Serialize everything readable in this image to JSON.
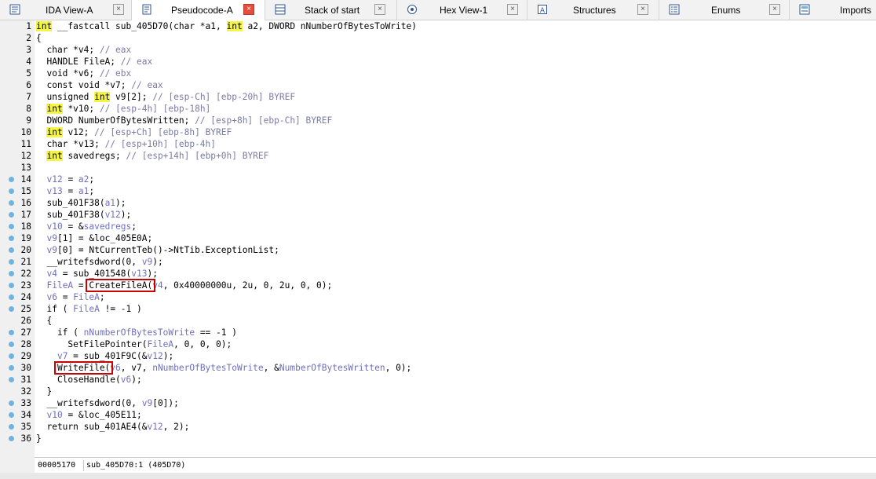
{
  "tabs": [
    {
      "label": "IDA View-A",
      "icon": "ida-view-icon",
      "active": false
    },
    {
      "label": "Pseudocode-A",
      "icon": "pseudocode-icon",
      "active": true
    },
    {
      "label": "Stack of start",
      "icon": "stack-icon",
      "active": false
    },
    {
      "label": "Hex View-1",
      "icon": "hex-view-icon",
      "active": false
    },
    {
      "label": "Structures",
      "icon": "structures-icon",
      "active": false
    },
    {
      "label": "Enums",
      "icon": "enums-icon",
      "active": false
    },
    {
      "label": "Imports",
      "icon": "imports-icon",
      "active": false
    }
  ],
  "code": {
    "lines": [
      {
        "n": "1",
        "dot": false,
        "tokens": [
          [
            "kw",
            "int"
          ],
          [
            "p",
            " __fastcall sub_405D70(char *a1, "
          ],
          [
            "kw",
            "int"
          ],
          [
            "p",
            " a2, DWORD nNumberOfBytesToWrite)"
          ]
        ]
      },
      {
        "n": "2",
        "dot": false,
        "tokens": [
          [
            "p",
            "{"
          ]
        ]
      },
      {
        "n": "3",
        "dot": false,
        "tokens": [
          [
            "p",
            "  char *v4; "
          ],
          [
            "cm",
            "// eax"
          ]
        ]
      },
      {
        "n": "4",
        "dot": false,
        "tokens": [
          [
            "p",
            "  HANDLE FileA; "
          ],
          [
            "cm",
            "// eax"
          ]
        ]
      },
      {
        "n": "5",
        "dot": false,
        "tokens": [
          [
            "p",
            "  void *v6; "
          ],
          [
            "cm",
            "// ebx"
          ]
        ]
      },
      {
        "n": "6",
        "dot": false,
        "tokens": [
          [
            "p",
            "  const void *v7; "
          ],
          [
            "cm",
            "// eax"
          ]
        ]
      },
      {
        "n": "7",
        "dot": false,
        "tokens": [
          [
            "p",
            "  unsigned "
          ],
          [
            "kw",
            "int"
          ],
          [
            "p",
            " v9[2]; "
          ],
          [
            "cm",
            "// [esp-Ch] [ebp-20h] BYREF"
          ]
        ]
      },
      {
        "n": "8",
        "dot": false,
        "tokens": [
          [
            "p",
            "  "
          ],
          [
            "kw",
            "int"
          ],
          [
            "p",
            " *v10; "
          ],
          [
            "cm",
            "// [esp-4h] [ebp-18h]"
          ]
        ]
      },
      {
        "n": "9",
        "dot": false,
        "tokens": [
          [
            "p",
            "  DWORD NumberOfBytesWritten; "
          ],
          [
            "cm",
            "// [esp+8h] [ebp-Ch] BYREF"
          ]
        ]
      },
      {
        "n": "10",
        "dot": false,
        "tokens": [
          [
            "p",
            "  "
          ],
          [
            "kw",
            "int"
          ],
          [
            "p",
            " v12; "
          ],
          [
            "cm",
            "// [esp+Ch] [ebp-8h] BYREF"
          ]
        ]
      },
      {
        "n": "11",
        "dot": false,
        "tokens": [
          [
            "p",
            "  char *v13; "
          ],
          [
            "cm",
            "// [esp+10h] [ebp-4h]"
          ]
        ]
      },
      {
        "n": "12",
        "dot": false,
        "tokens": [
          [
            "p",
            "  "
          ],
          [
            "kw",
            "int"
          ],
          [
            "p",
            " savedregs; "
          ],
          [
            "cm",
            "// [esp+14h] [ebp+0h] BYREF"
          ]
        ]
      },
      {
        "n": "13",
        "dot": false,
        "tokens": []
      },
      {
        "n": "14",
        "dot": true,
        "tokens": [
          [
            "p",
            "  "
          ],
          [
            "vr",
            "v12"
          ],
          [
            "p",
            " = "
          ],
          [
            "vr",
            "a2"
          ],
          [
            "p",
            ";"
          ]
        ]
      },
      {
        "n": "15",
        "dot": true,
        "tokens": [
          [
            "p",
            "  "
          ],
          [
            "vr",
            "v13"
          ],
          [
            "p",
            " = "
          ],
          [
            "vr",
            "a1"
          ],
          [
            "p",
            ";"
          ]
        ]
      },
      {
        "n": "16",
        "dot": true,
        "tokens": [
          [
            "p",
            "  sub_401F38("
          ],
          [
            "vr",
            "a1"
          ],
          [
            "p",
            ");"
          ]
        ]
      },
      {
        "n": "17",
        "dot": true,
        "tokens": [
          [
            "p",
            "  sub_401F38("
          ],
          [
            "vr",
            "v12"
          ],
          [
            "p",
            ");"
          ]
        ]
      },
      {
        "n": "18",
        "dot": true,
        "tokens": [
          [
            "p",
            "  "
          ],
          [
            "vr",
            "v10"
          ],
          [
            "p",
            " = &"
          ],
          [
            "vr",
            "savedregs"
          ],
          [
            "p",
            ";"
          ]
        ]
      },
      {
        "n": "19",
        "dot": true,
        "tokens": [
          [
            "p",
            "  "
          ],
          [
            "vr",
            "v9"
          ],
          [
            "p",
            "[1] = &loc_405E0A;"
          ]
        ]
      },
      {
        "n": "20",
        "dot": true,
        "tokens": [
          [
            "p",
            "  "
          ],
          [
            "vr",
            "v9"
          ],
          [
            "p",
            "[0] = NtCurrentTeb()->NtTib.ExceptionList;"
          ]
        ]
      },
      {
        "n": "21",
        "dot": true,
        "tokens": [
          [
            "p",
            "  __writefsdword(0, "
          ],
          [
            "vr",
            "v9"
          ],
          [
            "p",
            ");"
          ]
        ]
      },
      {
        "n": "22",
        "dot": true,
        "tokens": [
          [
            "p",
            "  "
          ],
          [
            "vr",
            "v4"
          ],
          [
            "p",
            " = sub_401548("
          ],
          [
            "vr",
            "v13"
          ],
          [
            "p",
            ");"
          ]
        ]
      },
      {
        "n": "23",
        "dot": true,
        "tokens": [
          [
            "p",
            "  "
          ],
          [
            "vr",
            "FileA"
          ],
          [
            "p",
            " = CreateFileA("
          ],
          [
            "vr",
            "v4"
          ],
          [
            "p",
            ", 0x40000000u, 2u, 0, 2u, 0, 0);"
          ]
        ]
      },
      {
        "n": "24",
        "dot": true,
        "tokens": [
          [
            "p",
            "  "
          ],
          [
            "vr",
            "v6"
          ],
          [
            "p",
            " = "
          ],
          [
            "vr",
            "FileA"
          ],
          [
            "p",
            ";"
          ]
        ]
      },
      {
        "n": "25",
        "dot": true,
        "tokens": [
          [
            "p",
            "  if ( "
          ],
          [
            "vr",
            "FileA"
          ],
          [
            "p",
            " != -1 )"
          ]
        ]
      },
      {
        "n": "26",
        "dot": false,
        "tokens": [
          [
            "p",
            "  {"
          ]
        ]
      },
      {
        "n": "27",
        "dot": true,
        "tokens": [
          [
            "p",
            "    if ( "
          ],
          [
            "vr",
            "nNumberOfBytesToWrite"
          ],
          [
            "p",
            " == -1 )"
          ]
        ]
      },
      {
        "n": "28",
        "dot": true,
        "tokens": [
          [
            "p",
            "      SetFilePointer("
          ],
          [
            "vr",
            "FileA"
          ],
          [
            "p",
            ", 0, 0, 0);"
          ]
        ]
      },
      {
        "n": "29",
        "dot": true,
        "tokens": [
          [
            "p",
            "    "
          ],
          [
            "vr",
            "v7"
          ],
          [
            "p",
            " = sub_401F9C(&"
          ],
          [
            "vr",
            "v12"
          ],
          [
            "p",
            ");"
          ]
        ]
      },
      {
        "n": "30",
        "dot": true,
        "tokens": [
          [
            "p",
            "    WriteFile("
          ],
          [
            "vr",
            "v6"
          ],
          [
            "p",
            ", v7, "
          ],
          [
            "vr",
            "nNumberOfBytesToWrite"
          ],
          [
            "p",
            ", &"
          ],
          [
            "vr",
            "NumberOfBytesWritten"
          ],
          [
            "p",
            ", 0);"
          ]
        ]
      },
      {
        "n": "31",
        "dot": true,
        "tokens": [
          [
            "p",
            "    CloseHandle("
          ],
          [
            "vr",
            "v6"
          ],
          [
            "p",
            ");"
          ]
        ]
      },
      {
        "n": "32",
        "dot": false,
        "tokens": [
          [
            "p",
            "  }"
          ]
        ]
      },
      {
        "n": "33",
        "dot": true,
        "tokens": [
          [
            "p",
            "  __writefsdword(0, "
          ],
          [
            "vr",
            "v9"
          ],
          [
            "p",
            "[0]);"
          ]
        ]
      },
      {
        "n": "34",
        "dot": true,
        "tokens": [
          [
            "p",
            "  "
          ],
          [
            "vr",
            "v10"
          ],
          [
            "p",
            " = &loc_405E11;"
          ]
        ]
      },
      {
        "n": "35",
        "dot": true,
        "tokens": [
          [
            "p",
            "  return sub_401AE4(&"
          ],
          [
            "vr",
            "v12"
          ],
          [
            "p",
            ", 2);"
          ]
        ]
      },
      {
        "n": "36",
        "dot": true,
        "tokens": [
          [
            "p",
            "}"
          ]
        ]
      }
    ],
    "highlight_keyword_color": "#f5f545",
    "comment_color": "#7b7ba6",
    "variable_color": "#6f6fbf"
  },
  "annotations": {
    "box_color": "#cc0000",
    "boxed_calls": [
      "CreateFileA",
      "WriteFile"
    ]
  },
  "status": {
    "address": "00005170",
    "location": "sub_405D70:1 (405D70)"
  }
}
